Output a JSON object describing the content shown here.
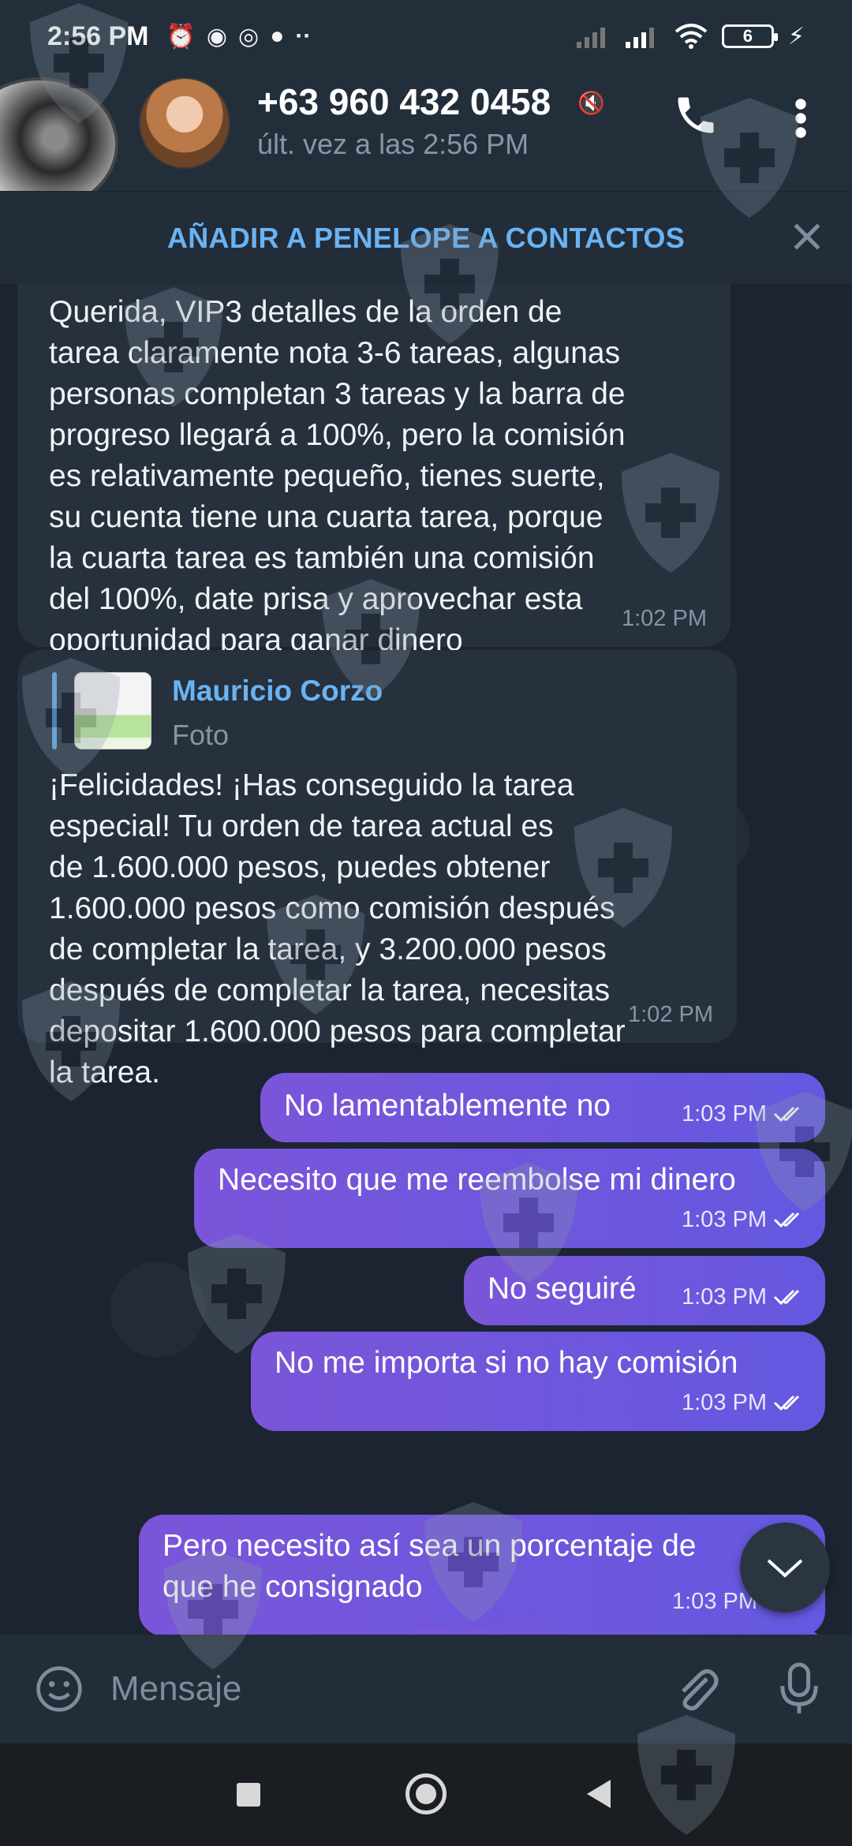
{
  "status_bar": {
    "time": "2:56 PM",
    "battery_level": "6",
    "icons": [
      "alarm-off-icon",
      "app-icon",
      "messenger-icon",
      "planet-icon",
      "more-dots-icon",
      "signal-icon",
      "signal-icon",
      "wifi-icon",
      "battery-icon",
      "charging-icon"
    ]
  },
  "header": {
    "contact_name": "+63 960 432 0458",
    "last_seen": "últ. vez a las 2:56 PM"
  },
  "add_contact_bar": {
    "label": "AÑADIR A PENELOPE A CONTACTOS"
  },
  "messages": [
    {
      "direction": "in",
      "text": "Querida, VIP3 detalles de la orden de\ntarea claramente nota 3-6 tareas, algunas\npersonas completan 3 tareas y la barra de\nprogreso llegará a 100%, pero la comisión\nes relativamente pequeño, tienes suerte,\nsu cuenta tiene una cuarta tarea, porque\nla cuarta tarea es también una comisión\ndel 100%, date prisa y aprovechar esta\noportunidad para ganar dinero",
      "time": "1:02 PM"
    },
    {
      "direction": "in",
      "reply": {
        "name": "Mauricio Corzo",
        "type": "Foto"
      },
      "text": "¡Felicidades! ¡Has conseguido la tarea\nespecial! Tu orden de tarea actual es\nde 1.600.000 pesos, puedes obtener\n1.600.000 pesos como comisión después\nde completar la tarea, y 3.200.000 pesos\ndespués de completar la tarea, necesitas\ndepositar 1.600.000 pesos para completar\nla tarea.",
      "time": "1:02 PM"
    },
    {
      "direction": "out",
      "text": "No lamentablemente no",
      "time": "1:03 PM"
    },
    {
      "direction": "out",
      "text": "Necesito que me reembolse mi dinero",
      "time": "1:03 PM"
    },
    {
      "direction": "out",
      "text": "No seguiré",
      "time": "1:03 PM"
    },
    {
      "direction": "out",
      "text": "No me importa si no hay comisión",
      "time": "1:03 PM"
    },
    {
      "direction": "out",
      "text": "Pero necesito así sea un porcentaje de\nque he consignado",
      "time": "1:03 PM"
    }
  ],
  "input": {
    "placeholder": "Mensaje"
  },
  "colors": {
    "accent_link": "#6ab3f3",
    "outgoing_bubble": "#6f57dc",
    "incoming_bubble": "#26313d",
    "background": "#1b2430"
  }
}
